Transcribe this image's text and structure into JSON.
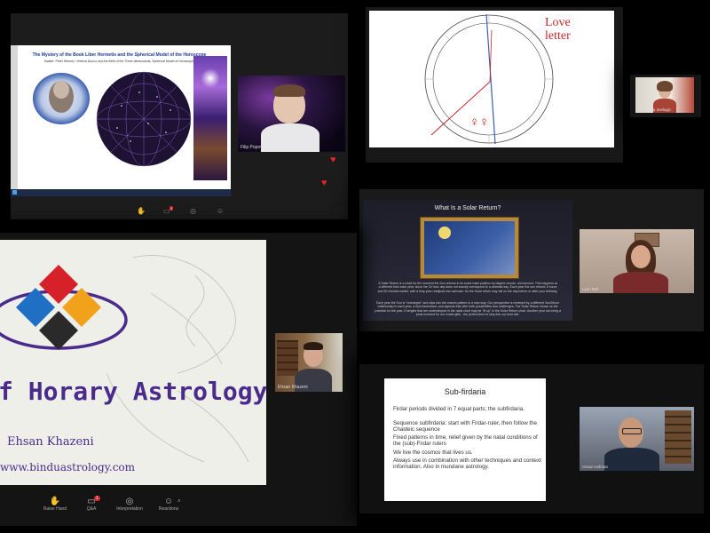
{
  "hermetis_slide": {
    "title": "The Mystery of the Book Liber Hermetis and the Spherical Model of the Horoscope",
    "subtitle": "Master: Peter Stonolv • Helena Douvo and the Birth of the Three-dimensional, Spherical Model of Horoscope"
  },
  "participants": {
    "filip": "Filip Popov",
    "alexandra": "Alexandra Imelagic",
    "lynn": "Lynn Bell",
    "ehsan": "Ehsan Khazeni",
    "oscar": "Oscar Hofman"
  },
  "love_slide": {
    "text": "Love letter"
  },
  "solar_slide": {
    "title": "What Is a Solar Return?",
    "para1": "A Solar Return is a chart for the moment the Sun returns to its exact natal position by degree minute, and second. This happens at a different time each year, since the 24 hour day does not exactly correspond to a celestial day. Each year the sun returns 5 hours and 50 minutes earlier, with a leap year readjusts the calendar. So the Solar return may fall on the day before or after your birthday.",
    "para2": "Each year the Sun is \"recharged\" and slips into the cosmic pattern in a new way. Our perspective is renewed by a different Sun/Moon relationship in each year, a new Ascendant, and aspects that offer both possibilities and challenges. The Solar Return shows us the potential for the year. Energies that are undeveloped in the natal chart may be \"lit up\" in the Solar Return chart. Another year can bring a peak moment for our innate gifts - the perfect time to step into our best self."
  },
  "horary_slide": {
    "title": "f Horary Astrology",
    "author": "Ehsan Khazeni",
    "url": "www.binduastrology.com"
  },
  "firdar_slide": {
    "title": "Sub-firdaria",
    "bullets": [
      "Firdar periods divided in 7 equal parts; the subfirdaria.",
      "Sequence subfirdaria: start with Firdar-ruler, then follow the Chaldeic sequence",
      "Fixed patterns in time, relief given by the natal conditions of the (sub)-Firdar rulers",
      "We live the cosmos that lives us.",
      "Always use in combination with other techniques and context information. Also in mundane astrology."
    ]
  },
  "toolbar_bottom": [
    {
      "label": "Raise Hand",
      "icon": "hand-icon"
    },
    {
      "label": "Q&A",
      "icon": "qa-icon",
      "badge": "1"
    },
    {
      "label": "Interpretation",
      "icon": "globe-icon"
    },
    {
      "label": "Reactions",
      "icon": "reactions-icon"
    }
  ],
  "colors": {
    "love_red": "#c8272b",
    "horary_purple": "#4a2b8c",
    "heart": "#e0242a"
  }
}
